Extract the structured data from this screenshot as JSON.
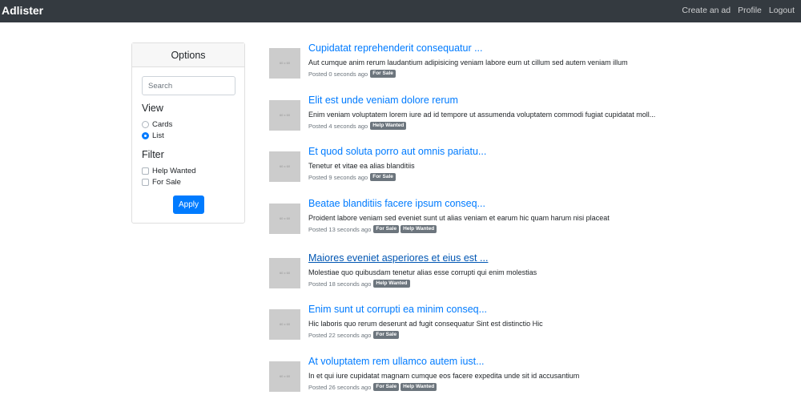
{
  "navbar": {
    "brand": "Adlister",
    "links": [
      "Create an ad",
      "Profile",
      "Logout"
    ],
    "background": "#343a40"
  },
  "options": {
    "header": "Options",
    "search_placeholder": "Search",
    "view_title": "View",
    "view_options": [
      {
        "label": "Cards",
        "checked": false
      },
      {
        "label": "List",
        "checked": true
      }
    ],
    "filter_title": "Filter",
    "filter_options": [
      {
        "label": "Help Wanted",
        "checked": false
      },
      {
        "label": "For Sale",
        "checked": false
      }
    ],
    "apply_label": "Apply",
    "accent": "#007bff"
  },
  "listings": [
    {
      "title": "Cupidatat reprehenderit consequatur ...",
      "description": "Aut cumque anim rerum laudantium adipisicing veniam labore eum ut cillum sed autem veniam illum",
      "posted": "Posted 0 seconds ago",
      "badges": [
        "For Sale"
      ],
      "thumb_text": "60 x 60"
    },
    {
      "title": "Elit est unde veniam dolore rerum",
      "description": "Enim veniam voluptatem lorem iure ad id tempore ut assumenda voluptatem commodi fugiat cupidatat moll...",
      "posted": "Posted 4 seconds ago",
      "badges": [
        "Help Wanted"
      ],
      "thumb_text": "60 x 60"
    },
    {
      "title": "Et quod soluta porro aut omnis pariatu...",
      "description": "Tenetur et vitae ea alias blanditiis",
      "posted": "Posted 9 seconds ago",
      "badges": [
        "For Sale"
      ],
      "thumb_text": "60 x 60"
    },
    {
      "title": "Beatae blanditiis facere ipsum conseq...",
      "description": "Proident labore veniam sed eveniet sunt ut alias veniam et earum hic quam harum nisi placeat",
      "posted": "Posted 13 seconds ago",
      "badges": [
        "For Sale",
        "Help Wanted"
      ],
      "thumb_text": "60 x 60"
    },
    {
      "title": "Maiores eveniet asperiores et eius est ...",
      "description": "Molestiae quo quibusdam tenetur alias esse corrupti qui enim molestias",
      "posted": "Posted 18 seconds ago",
      "badges": [
        "Help Wanted"
      ],
      "thumb_text": "60 x 60",
      "hovered": true
    },
    {
      "title": "Enim sunt ut corrupti ea minim conseq...",
      "description": "Hic laboris quo rerum deserunt ad fugit consequatur Sint est distinctio Hic",
      "posted": "Posted 22 seconds ago",
      "badges": [
        "For Sale"
      ],
      "thumb_text": "60 x 60"
    },
    {
      "title": "At voluptatem rem ullamco autem iust...",
      "description": "In et qui iure cupidatat magnam cumque eos facere expedita unde sit id accusantium",
      "posted": "Posted 26 seconds ago",
      "badges": [
        "For Sale",
        "Help Wanted"
      ],
      "thumb_text": "60 x 60"
    }
  ]
}
